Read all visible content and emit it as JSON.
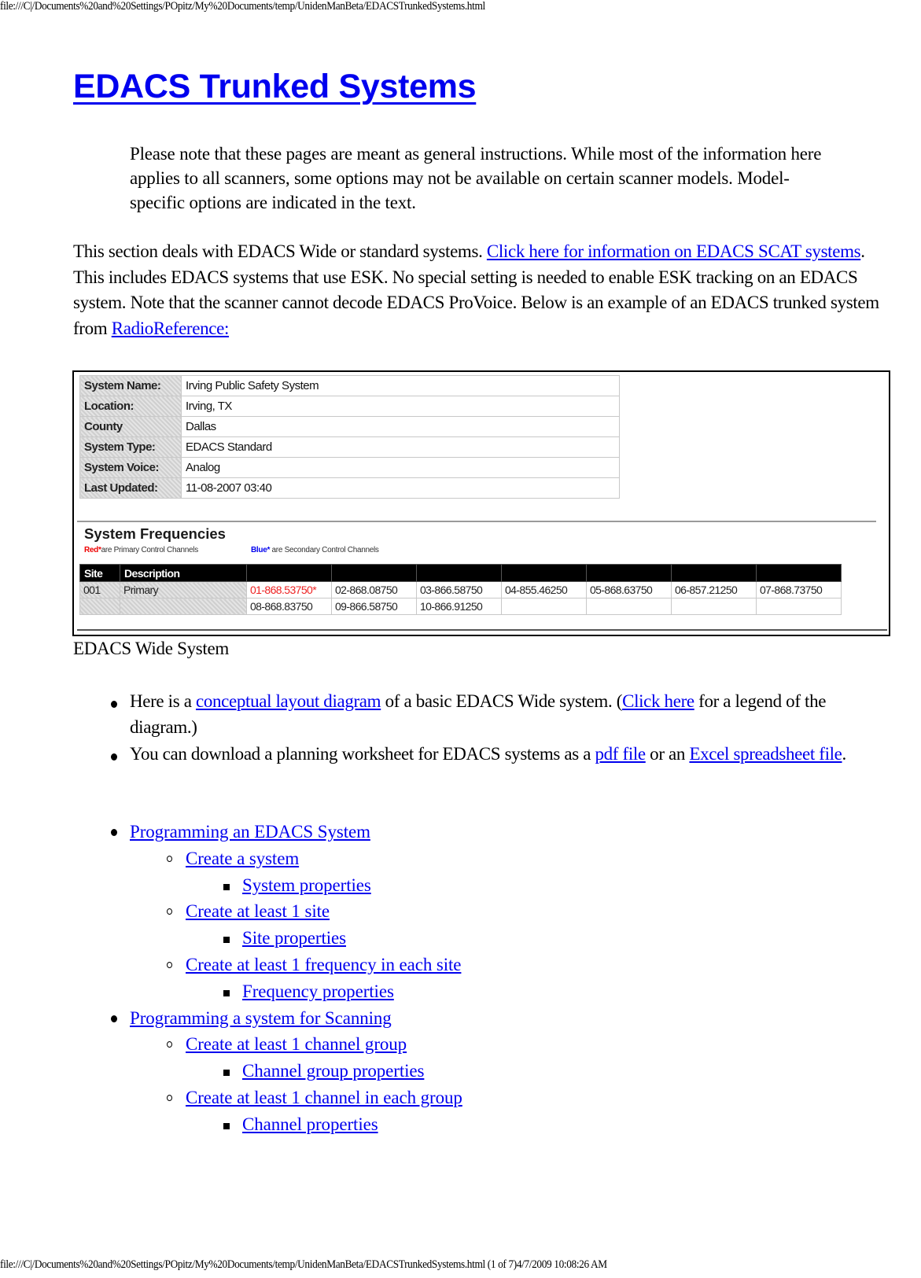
{
  "header_path": "file:///C|/Documents%20and%20Settings/POpitz/My%20Documents/temp/UnidenManBeta/EDACSTrunkedSystems.html",
  "footer_path": "file:///C|/Documents%20and%20Settings/POpitz/My%20Documents/temp/UnidenManBeta/EDACSTrunkedSystems.html (1 of 7)4/7/2009 10:08:26 AM",
  "title": "EDACS Trunked Systems",
  "note": "Please note that these pages are meant as general instructions. While most of the information here applies to all scanners, some options may not be available on certain scanner models. Model-specific options are indicated in the text.",
  "intro": {
    "part1": "This section deals with EDACS Wide or standard systems. ",
    "link_scat": "Click here for information on EDACS SCAT systems",
    "part2": ". This includes EDACS systems that use ESK. No special setting is needed to enable ESK tracking on an EDACS system. Note that the scanner cannot decode EDACS ProVoice. Below is an example of an EDACS trunked system from ",
    "link_rr": "RadioReference:"
  },
  "figure": {
    "info_rows": [
      {
        "label": "System Name:",
        "value": "Irving Public Safety System"
      },
      {
        "label": "Location:",
        "value": "Irving, TX"
      },
      {
        "label": "County",
        "value": "Dallas"
      },
      {
        "label": "System Type:",
        "value": "EDACS Standard"
      },
      {
        "label": "System Voice:",
        "value": "Analog"
      },
      {
        "label": "Last Updated:",
        "value": "11-08-2007 03:40"
      }
    ],
    "freq_title": "System Frequencies",
    "legend_red_word": "Red*",
    "legend_red_text": "are Primary Control Channels",
    "legend_blue_word": "Blue*",
    "legend_blue_text": " are Secondary Control Channels",
    "freq_headers": [
      "Site",
      "Description",
      "",
      "",
      "",
      "",
      "",
      "",
      ""
    ],
    "freq_rows": [
      {
        "site": "001",
        "description": "Primary",
        "freqs": [
          "01-868.53750*",
          "02-868.08750",
          "03-866.58750",
          "04-855.46250",
          "05-868.63750",
          "06-857.21250",
          "07-868.73750"
        ],
        "primary_index": 0
      },
      {
        "site": "",
        "description": "",
        "freqs": [
          "08-868.83750",
          "09-866.58750",
          "10-866.91250",
          "",
          "",
          "",
          ""
        ],
        "primary_index": -1
      }
    ]
  },
  "caption": "EDACS Wide System",
  "bullets": {
    "b1_pre": "Here is a ",
    "b1_link1": "conceptual layout diagram",
    "b1_mid": " of a basic EDACS Wide system. (",
    "b1_link2": "Click here",
    "b1_post": " for a legend of the diagram.)",
    "b2_pre": "You can download a planning worksheet for EDACS systems as a ",
    "b2_link1": "pdf file",
    "b2_mid": " or an ",
    "b2_link2": "Excel spreadsheet file",
    "b2_post": "."
  },
  "toc": [
    {
      "level": 1,
      "label": "Programming an EDACS System"
    },
    {
      "level": 2,
      "label": "Create a system"
    },
    {
      "level": 3,
      "label": "System properties"
    },
    {
      "level": 2,
      "label": "Create at least 1 site"
    },
    {
      "level": 3,
      "label": "Site properties"
    },
    {
      "level": 2,
      "label": "Create at least 1 frequency in each site"
    },
    {
      "level": 3,
      "label": "Frequency properties"
    },
    {
      "level": 1,
      "label": "Programming a system for Scanning"
    },
    {
      "level": 2,
      "label": "Create at least 1 channel group"
    },
    {
      "level": 3,
      "label": "Channel group properties"
    },
    {
      "level": 2,
      "label": "Create at least 1 channel in each group"
    },
    {
      "level": 3,
      "label": "Channel properties"
    }
  ]
}
